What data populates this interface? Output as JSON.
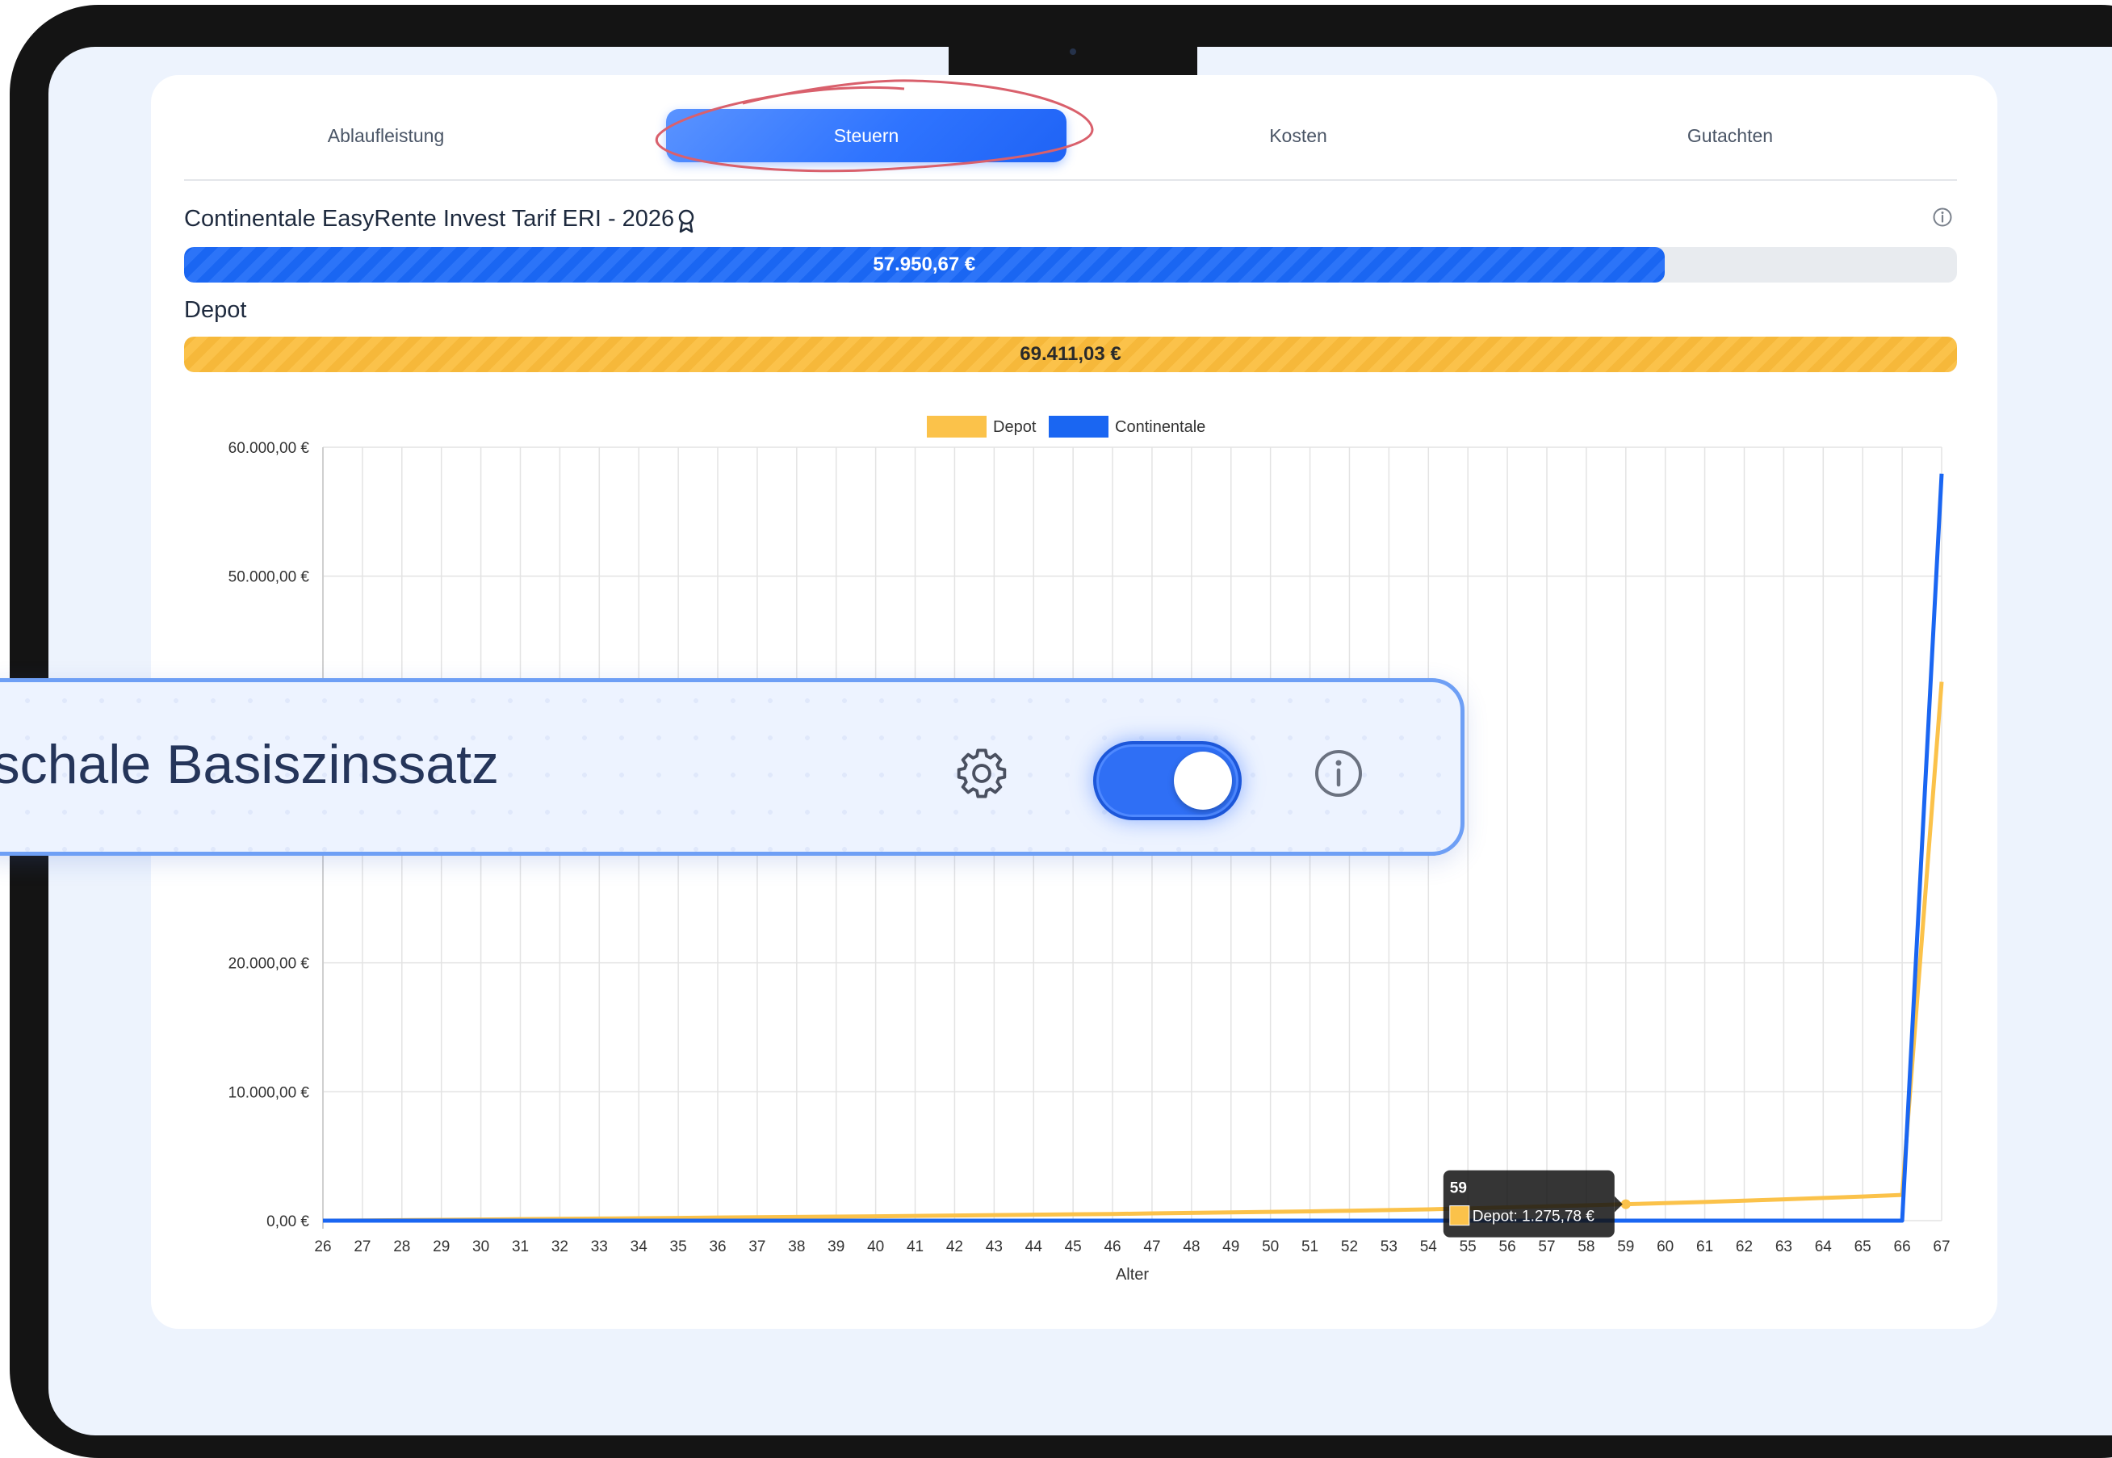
{
  "tabs": [
    {
      "label": "Ablaufleistung",
      "active": false
    },
    {
      "label": "Steuern",
      "active": true
    },
    {
      "label": "Kosten",
      "active": false
    },
    {
      "label": "Gutachten",
      "active": false
    }
  ],
  "products": [
    {
      "title": "Continentale EasyRente Invest Tarif ERI - 2026",
      "value_label": "57.950,67 €",
      "fill_fraction": 0.835,
      "color": "#1a66f2"
    },
    {
      "title": "Depot",
      "value_label": "69.411,03 €",
      "fill_fraction": 1.0,
      "color": "#fbc24a"
    }
  ],
  "overlay": {
    "label": "Pauschale Basiszinssatz",
    "toggle_on": true,
    "icons": [
      "gear-icon",
      "info-icon"
    ]
  },
  "chart_data": {
    "type": "line",
    "xlabel": "Alter",
    "ylabel": "",
    "x": [
      26,
      27,
      28,
      29,
      30,
      31,
      32,
      33,
      34,
      35,
      36,
      37,
      38,
      39,
      40,
      41,
      42,
      43,
      44,
      45,
      46,
      47,
      48,
      49,
      50,
      51,
      52,
      53,
      54,
      55,
      56,
      57,
      58,
      59,
      60,
      61,
      62,
      63,
      64,
      65,
      66,
      67
    ],
    "ylim": [
      0,
      60000
    ],
    "yticks": [
      {
        "value": 0,
        "label": "0,00 €"
      },
      {
        "value": 10000,
        "label": "10.000,00 €"
      },
      {
        "value": 20000,
        "label": "20.000,00 €"
      },
      {
        "value": 50000,
        "label": "50.000,00 €"
      },
      {
        "value": 60000,
        "label": "60.000,00 €"
      }
    ],
    "series": [
      {
        "name": "Depot",
        "color": "#fbc24a",
        "values": [
          0,
          15,
          40,
          65,
          90,
          115,
          140,
          165,
          190,
          215,
          240,
          265,
          290,
          315,
          340,
          370,
          400,
          430,
          460,
          490,
          520,
          560,
          600,
          640,
          680,
          720,
          770,
          820,
          880,
          950,
          1030,
          1110,
          1190,
          1275.78,
          1360,
          1450,
          1550,
          1650,
          1760,
          1870,
          2000,
          41800
        ]
      },
      {
        "name": "Continentale",
        "color": "#1a66f2",
        "values": [
          0,
          0,
          0,
          0,
          0,
          0,
          0,
          0,
          0,
          0,
          0,
          0,
          0,
          0,
          0,
          0,
          0,
          0,
          0,
          0,
          0,
          0,
          0,
          0,
          0,
          0,
          0,
          0,
          0,
          0,
          0,
          0,
          0,
          0,
          0,
          0,
          0,
          0,
          0,
          0,
          0,
          57950.67
        ]
      }
    ],
    "legend_position": "top-center",
    "tooltip": {
      "title": "59",
      "text": "Depot: 1.275,78 €",
      "series": "Depot",
      "x": 59
    }
  }
}
